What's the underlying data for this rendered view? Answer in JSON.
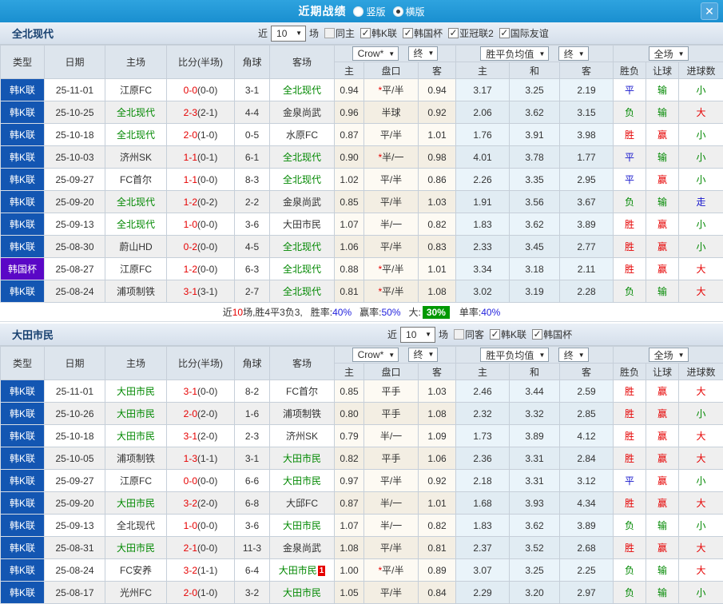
{
  "icons": {
    "dropdown": "▼",
    "check": "✓",
    "close": "✕"
  },
  "colors": {
    "titlebar_blue": "#1e96d6",
    "league_blue": "#1356b2",
    "cup_purple": "#5a07c6",
    "win_red": "#e60000",
    "draw_blue": "#1414cc",
    "lose_green": "#008800",
    "summary_green": "#009900",
    "value_blue": "#2222dd"
  },
  "titlebar": {
    "title": "近期战绩",
    "vertical_label": "竖版",
    "horizontal_label": "横版"
  },
  "header": {
    "type": "类型",
    "date": "日期",
    "home": "主场",
    "score": "比分(半场)",
    "corner": "角球",
    "away": "客场",
    "company_select": "Crow*",
    "final_label": "终",
    "avg_select": "胜平负均值",
    "scope_select": "全场",
    "sub_home": "主",
    "sub_handicap": "盘口",
    "sub_away": "客",
    "sub_win": "主",
    "sub_draw": "和",
    "sub_lose": "客",
    "sub_result": "胜负",
    "sub_spread": "让球",
    "sub_goals": "进球数"
  },
  "sections": [
    {
      "team": "全北现代",
      "filter": {
        "near": "近",
        "count": "10",
        "games": "场",
        "same_label": "同主",
        "same_checked": false,
        "leagues": [
          {
            "label": "韩K联",
            "checked": true
          },
          {
            "label": "韩国杯",
            "checked": true
          },
          {
            "label": "亚冠联2",
            "checked": true
          },
          {
            "label": "国际友谊",
            "checked": true
          }
        ]
      },
      "rows": [
        {
          "type": "韩K联",
          "date": "25-11-01",
          "home": "江原FC",
          "hf": false,
          "ft": "0-0",
          "ht": "(0-0)",
          "cn": "3-1",
          "away": "全北现代",
          "af": true,
          "o1": "0.94",
          "star": true,
          "hc": "平/半",
          "o2": "0.94",
          "a1": "3.17",
          "a2": "3.25",
          "a3": "2.19",
          "res": "平",
          "sp": "输",
          "gl": "小"
        },
        {
          "type": "韩K联",
          "date": "25-10-25",
          "home": "全北现代",
          "hf": true,
          "ft": "2-3",
          "ht": "(2-1)",
          "cn": "4-4",
          "away": "金泉尚武",
          "af": false,
          "o1": "0.96",
          "hc": "半球",
          "o2": "0.92",
          "a1": "2.06",
          "a2": "3.62",
          "a3": "3.15",
          "res": "负",
          "sp": "输",
          "gl": "大"
        },
        {
          "type": "韩K联",
          "date": "25-10-18",
          "home": "全北现代",
          "hf": true,
          "ft": "2-0",
          "ht": "(1-0)",
          "cn": "0-5",
          "away": "水原FC",
          "af": false,
          "o1": "0.87",
          "hc": "平/半",
          "o2": "1.01",
          "a1": "1.76",
          "a2": "3.91",
          "a3": "3.98",
          "res": "胜",
          "sp": "赢",
          "gl": "小"
        },
        {
          "type": "韩K联",
          "date": "25-10-03",
          "home": "济州SK",
          "hf": false,
          "ft": "1-1",
          "ht": "(0-1)",
          "cn": "6-1",
          "away": "全北现代",
          "af": true,
          "o1": "0.90",
          "star": true,
          "hc": "半/一",
          "o2": "0.98",
          "a1": "4.01",
          "a2": "3.78",
          "a3": "1.77",
          "res": "平",
          "sp": "输",
          "gl": "小"
        },
        {
          "type": "韩K联",
          "date": "25-09-27",
          "home": "FC首尔",
          "hf": false,
          "ft": "1-1",
          "ht": "(0-0)",
          "cn": "8-3",
          "away": "全北现代",
          "af": true,
          "o1": "1.02",
          "hc": "平/半",
          "o2": "0.86",
          "a1": "2.26",
          "a2": "3.35",
          "a3": "2.95",
          "res": "平",
          "sp": "赢",
          "gl": "小"
        },
        {
          "type": "韩K联",
          "date": "25-09-20",
          "home": "全北现代",
          "hf": true,
          "ft": "1-2",
          "ht": "(0-2)",
          "cn": "2-2",
          "away": "金泉尚武",
          "af": false,
          "o1": "0.85",
          "hc": "平/半",
          "o2": "1.03",
          "a1": "1.91",
          "a2": "3.56",
          "a3": "3.67",
          "res": "负",
          "sp": "输",
          "gl": "走"
        },
        {
          "type": "韩K联",
          "date": "25-09-13",
          "home": "全北现代",
          "hf": true,
          "ft": "1-0",
          "ht": "(0-0)",
          "cn": "3-6",
          "away": "大田市民",
          "af": false,
          "o1": "1.07",
          "hc": "半/一",
          "o2": "0.82",
          "a1": "1.83",
          "a2": "3.62",
          "a3": "3.89",
          "res": "胜",
          "sp": "赢",
          "gl": "小"
        },
        {
          "type": "韩K联",
          "date": "25-08-30",
          "home": "蔚山HD",
          "hf": false,
          "ft": "0-2",
          "ht": "(0-0)",
          "cn": "4-5",
          "away": "全北现代",
          "af": true,
          "o1": "1.06",
          "hc": "平/半",
          "o2": "0.83",
          "a1": "2.33",
          "a2": "3.45",
          "a3": "2.77",
          "res": "胜",
          "sp": "赢",
          "gl": "小"
        },
        {
          "type": "韩国杯",
          "date": "25-08-27",
          "home": "江原FC",
          "hf": false,
          "ft": "1-2",
          "ht": "(0-0)",
          "cn": "6-3",
          "away": "全北现代",
          "af": true,
          "o1": "0.88",
          "star": true,
          "hc": "平/半",
          "o2": "1.01",
          "a1": "3.34",
          "a2": "3.18",
          "a3": "2.11",
          "res": "胜",
          "sp": "赢",
          "gl": "大"
        },
        {
          "type": "韩K联",
          "date": "25-08-24",
          "home": "浦项制铁",
          "hf": false,
          "ft": "3-1",
          "ht": "(3-1)",
          "cn": "2-7",
          "away": "全北现代",
          "af": true,
          "o1": "0.81",
          "star": true,
          "hc": "平/半",
          "o2": "1.08",
          "a1": "3.02",
          "a2": "3.19",
          "a3": "2.28",
          "res": "负",
          "sp": "输",
          "gl": "大"
        }
      ],
      "summary": {
        "near": "近",
        "count": "10",
        "rest": "场,胜4平3负3,",
        "win_label": "胜率:",
        "win_value": "40%",
        "spread_label": "赢率:",
        "spread_value": "50%",
        "big_label": "大:",
        "big_value": "30%",
        "single_label": "单率:",
        "single_value": "40%"
      }
    },
    {
      "team": "大田市民",
      "filter": {
        "near": "近",
        "count": "10",
        "games": "场",
        "same_label": "同客",
        "same_checked": false,
        "leagues": [
          {
            "label": "韩K联",
            "checked": true
          },
          {
            "label": "韩国杯",
            "checked": true
          }
        ]
      },
      "rows": [
        {
          "type": "韩K联",
          "date": "25-11-01",
          "home": "大田市民",
          "hf": true,
          "ft": "3-1",
          "ht": "(0-0)",
          "cn": "8-2",
          "away": "FC首尔",
          "af": false,
          "o1": "0.85",
          "hc": "平手",
          "o2": "1.03",
          "a1": "2.46",
          "a2": "3.44",
          "a3": "2.59",
          "res": "胜",
          "sp": "赢",
          "gl": "大"
        },
        {
          "type": "韩K联",
          "date": "25-10-26",
          "home": "大田市民",
          "hf": true,
          "ft": "2-0",
          "ht": "(2-0)",
          "cn": "1-6",
          "away": "浦项制铁",
          "af": false,
          "o1": "0.80",
          "hc": "平手",
          "o2": "1.08",
          "a1": "2.32",
          "a2": "3.32",
          "a3": "2.85",
          "res": "胜",
          "sp": "赢",
          "gl": "小"
        },
        {
          "type": "韩K联",
          "date": "25-10-18",
          "home": "大田市民",
          "hf": true,
          "ft": "3-1",
          "ht": "(2-0)",
          "cn": "2-3",
          "away": "济州SK",
          "af": false,
          "o1": "0.79",
          "hc": "半/一",
          "o2": "1.09",
          "a1": "1.73",
          "a2": "3.89",
          "a3": "4.12",
          "res": "胜",
          "sp": "赢",
          "gl": "大"
        },
        {
          "type": "韩K联",
          "date": "25-10-05",
          "home": "浦项制铁",
          "hf": false,
          "ft": "1-3",
          "ht": "(1-1)",
          "cn": "3-1",
          "away": "大田市民",
          "af": true,
          "o1": "0.82",
          "hc": "平手",
          "o2": "1.06",
          "a1": "2.36",
          "a2": "3.31",
          "a3": "2.84",
          "res": "胜",
          "sp": "赢",
          "gl": "大"
        },
        {
          "type": "韩K联",
          "date": "25-09-27",
          "home": "江原FC",
          "hf": false,
          "ft": "0-0",
          "ht": "(0-0)",
          "cn": "6-6",
          "away": "大田市民",
          "af": true,
          "o1": "0.97",
          "hc": "平/半",
          "o2": "0.92",
          "a1": "2.18",
          "a2": "3.31",
          "a3": "3.12",
          "res": "平",
          "sp": "赢",
          "gl": "小"
        },
        {
          "type": "韩K联",
          "date": "25-09-20",
          "home": "大田市民",
          "hf": true,
          "ft": "3-2",
          "ht": "(2-0)",
          "cn": "6-8",
          "away": "大邱FC",
          "af": false,
          "o1": "0.87",
          "hc": "半/一",
          "o2": "1.01",
          "a1": "1.68",
          "a2": "3.93",
          "a3": "4.34",
          "res": "胜",
          "sp": "赢",
          "gl": "大"
        },
        {
          "type": "韩K联",
          "date": "25-09-13",
          "home": "全北现代",
          "hf": false,
          "ft": "1-0",
          "ht": "(0-0)",
          "cn": "3-6",
          "away": "大田市民",
          "af": true,
          "o1": "1.07",
          "hc": "半/一",
          "o2": "0.82",
          "a1": "1.83",
          "a2": "3.62",
          "a3": "3.89",
          "res": "负",
          "sp": "输",
          "gl": "小"
        },
        {
          "type": "韩K联",
          "date": "25-08-31",
          "home": "大田市民",
          "hf": true,
          "ft": "2-1",
          "ht": "(0-0)",
          "cn": "11-3",
          "away": "金泉尚武",
          "af": false,
          "o1": "1.08",
          "hc": "平/半",
          "o2": "0.81",
          "a1": "2.37",
          "a2": "3.52",
          "a3": "2.68",
          "res": "胜",
          "sp": "赢",
          "gl": "大"
        },
        {
          "type": "韩K联",
          "date": "25-08-24",
          "home": "FC安养",
          "hf": false,
          "ft": "3-2",
          "ht": "(1-1)",
          "cn": "6-4",
          "away": "大田市民",
          "af": true,
          "badge": "1",
          "o1": "1.00",
          "star": true,
          "hc": "平/半",
          "o2": "0.89",
          "a1": "3.07",
          "a2": "3.25",
          "a3": "2.25",
          "res": "负",
          "sp": "输",
          "gl": "大"
        },
        {
          "type": "韩K联",
          "date": "25-08-17",
          "home": "光州FC",
          "hf": false,
          "ft": "2-0",
          "ht": "(1-0)",
          "cn": "3-2",
          "away": "大田市民",
          "af": true,
          "o1": "1.05",
          "hc": "平/半",
          "o2": "0.84",
          "a1": "2.29",
          "a2": "3.20",
          "a3": "2.97",
          "res": "负",
          "sp": "输",
          "gl": "小"
        }
      ]
    }
  ]
}
